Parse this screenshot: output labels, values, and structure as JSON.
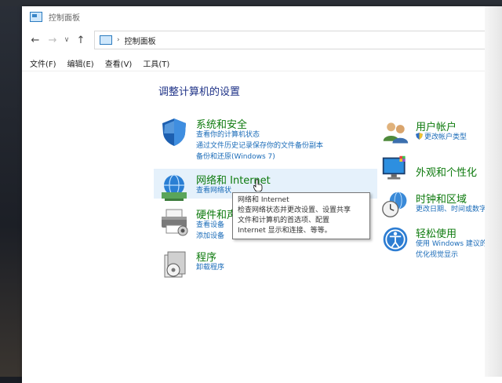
{
  "window": {
    "title": "控制面板"
  },
  "nav": {
    "back": "←",
    "forward": "→",
    "recent": "∨",
    "up": "↑"
  },
  "address": {
    "separator": "›",
    "crumb": "控制面板"
  },
  "menu": {
    "file": "文件(F)",
    "edit": "编辑(E)",
    "view": "查看(V)",
    "tools": "工具(T)"
  },
  "heading": "调整计算机的设置",
  "categories": {
    "system": {
      "title": "系统和安全",
      "links": [
        "查看你的计算机状态",
        "通过文件历史记录保存你的文件备份副本",
        "备份和还原(Windows 7)"
      ]
    },
    "network": {
      "title": "网络和 Internet",
      "links": [
        "查看网络状"
      ]
    },
    "hardware": {
      "title": "硬件和声",
      "links": [
        "查看设备",
        "添加设备"
      ]
    },
    "programs": {
      "title": "程序",
      "links": [
        "卸载程序"
      ]
    },
    "user": {
      "title": "用户帐户",
      "links": [
        "更改帐户类型"
      ]
    },
    "appearance": {
      "title": "外观和个性化",
      "links": []
    },
    "clock": {
      "title": "时钟和区域",
      "links": [
        "更改日期、时间或数字格"
      ]
    },
    "ease": {
      "title": "轻松使用",
      "links": [
        "使用 Windows 建议的设置",
        "优化视觉显示"
      ]
    }
  },
  "tooltip": {
    "lines": [
      "网络和 Internet",
      "检查网络状态并更改设置、设置共享",
      "文件和计算机的首选项、配置",
      "Internet 显示和连接、等等。"
    ]
  },
  "colors": {
    "link": "#1a6bb8",
    "category_title": "#0d7a0d",
    "heading": "#1e3287",
    "hover": "#e5f1fb"
  }
}
